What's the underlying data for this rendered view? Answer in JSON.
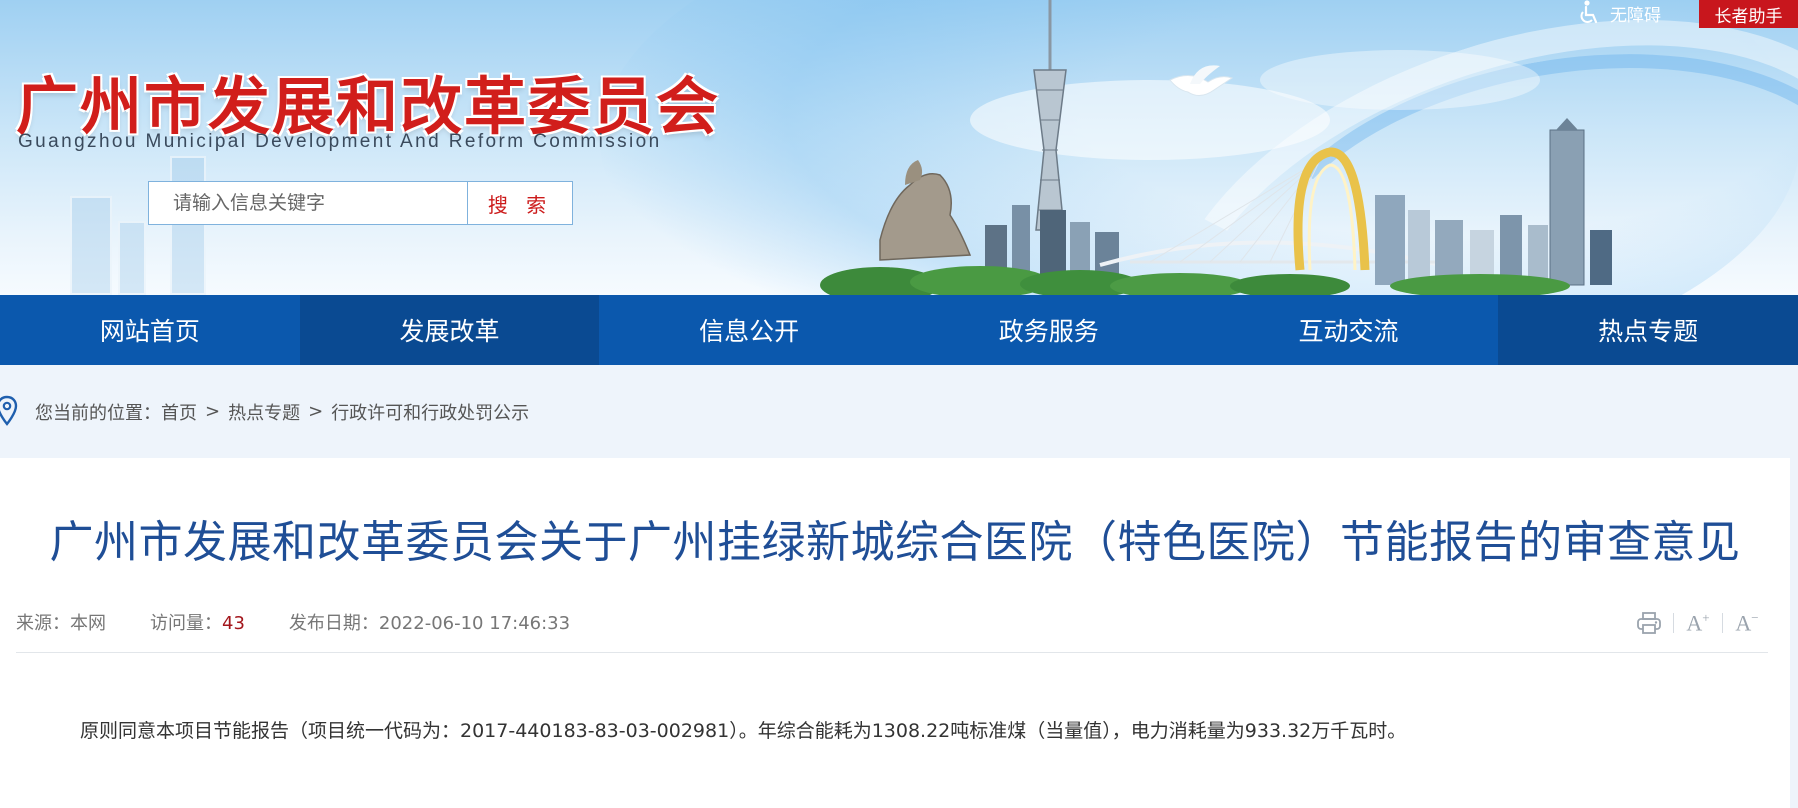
{
  "header": {
    "title_cn": "广州市发展和改革委员会",
    "title_en": "Guangzhou Municipal Development And Reform Commission",
    "search": {
      "placeholder": "请输入信息关键字",
      "button": "搜 索"
    },
    "accessibility": "无障碍",
    "elder_assistant": "长者助手"
  },
  "nav": {
    "items": [
      "网站首页",
      "发展改革",
      "信息公开",
      "政务服务",
      "互动交流",
      "热点专题"
    ]
  },
  "breadcrumb": {
    "prefix": "您当前的位置：",
    "items": [
      "首页",
      "热点专题",
      "行政许可和行政处罚公示"
    ],
    "separator": ">"
  },
  "article": {
    "title": "广州市发展和改革委员会关于广州挂绿新城综合医院（特色医院）节能报告的审查意见",
    "source_label": "来源：",
    "source": "本网",
    "views_label": "访问量：",
    "views": "43",
    "date_label": "发布日期：",
    "date": "2022-06-10 17:46:33",
    "tools": [
      "print-icon",
      "font-increase-icon",
      "font-decrease-icon"
    ],
    "body": "原则同意本项目节能报告（项目统一代码为：2017-440183-83-03-002981）。年综合能耗为1308.22吨标准煤（当量值），电力消耗量为933.32万千瓦时。"
  },
  "colors": {
    "brand_red": "#d11e1b",
    "nav_blue": "#0b58ad",
    "nav_active": "#0a4a92",
    "title_blue": "#1f4e96",
    "elder_red": "#c8161d"
  }
}
